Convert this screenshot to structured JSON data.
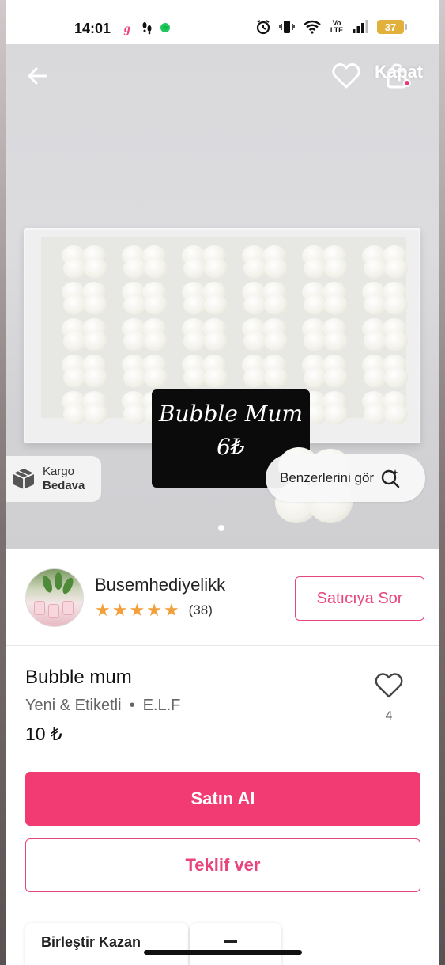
{
  "status_bar": {
    "time": "14:01",
    "battery": "37",
    "network": "Vo LTE"
  },
  "header": {
    "close_label": "Kapat"
  },
  "hero": {
    "card_name": "Bubble Mum",
    "card_price": "6₺",
    "shipping_line1": "Kargo",
    "shipping_line2": "Bedava",
    "similar_label": "Benzerlerini gör",
    "carousel_pages": 1,
    "carousel_active": 1
  },
  "seller": {
    "name": "Busemhediyelikk",
    "rating": 5,
    "review_count": "(38)",
    "ask_button": "Satıcıya Sor"
  },
  "product": {
    "title": "Bubble mum",
    "condition": "Yeni & Etiketli",
    "brand": "E.L.F",
    "price": "10 ₺",
    "favorite_count": "4"
  },
  "actions": {
    "buy_label": "Satın Al",
    "offer_label": "Teklif ver"
  },
  "bottom": {
    "card1_label": "Birleştir Kazan"
  },
  "colors": {
    "accent": "#f23b73",
    "star": "#f3a03a",
    "battery": "#e2b13c"
  }
}
